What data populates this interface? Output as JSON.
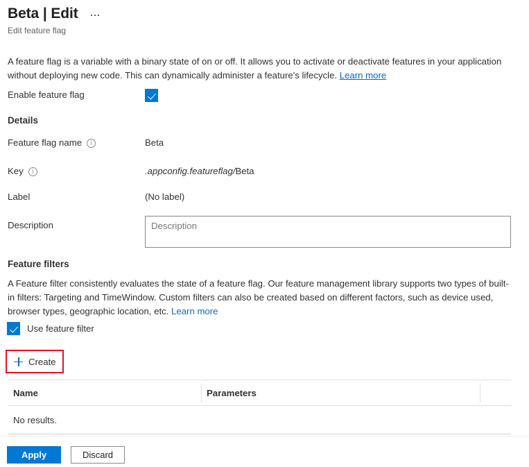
{
  "header": {
    "title": "Beta | Edit",
    "subtitle": "Edit feature flag",
    "more_menu": "..."
  },
  "intro": {
    "text": "A feature flag is a variable with a binary state of on or off. It allows you to activate or deactivate features in your application without deploying new code. This can dynamically administer a feature's lifecycle. ",
    "link_label": "Learn more"
  },
  "enable": {
    "label": "Enable feature flag",
    "checked": true
  },
  "details": {
    "heading": "Details",
    "fields": [
      {
        "label": "Feature flag name",
        "value": "Beta",
        "has_info": true
      },
      {
        "label": "Key",
        "value_italic": ".appconfig.featureflag/",
        "value_plain": "Beta",
        "has_info": true
      },
      {
        "label": "Label",
        "value": "(No label)",
        "has_info": false
      }
    ],
    "description": {
      "label": "Description",
      "value": "",
      "placeholder": "Description"
    }
  },
  "feature_filters": {
    "heading": "Feature filters",
    "description": "A Feature filter consistently evaluates the state of a feature flag. Our feature management library supports two types of built-in filters: Targeting and TimeWindow. Custom filters can also be created based on different factors, such as device used, browser types, geographic location, etc. ",
    "link_label": "Learn more",
    "use_filter_label": "Use feature filter",
    "use_filter_checked": true,
    "create_label": "Create",
    "create_icon": "plus-icon",
    "table": {
      "columns": [
        "Name",
        "Parameters",
        ""
      ],
      "rows": [],
      "empty_text": "No results."
    }
  },
  "footer": {
    "apply_label": "Apply",
    "discard_label": "Discard"
  },
  "colors": {
    "accent": "#0078d4",
    "link": "#0066cc",
    "link_alt": "#0f6cbd",
    "highlight_box": "#e81123",
    "text": "#323130",
    "muted": "#605e5c"
  }
}
